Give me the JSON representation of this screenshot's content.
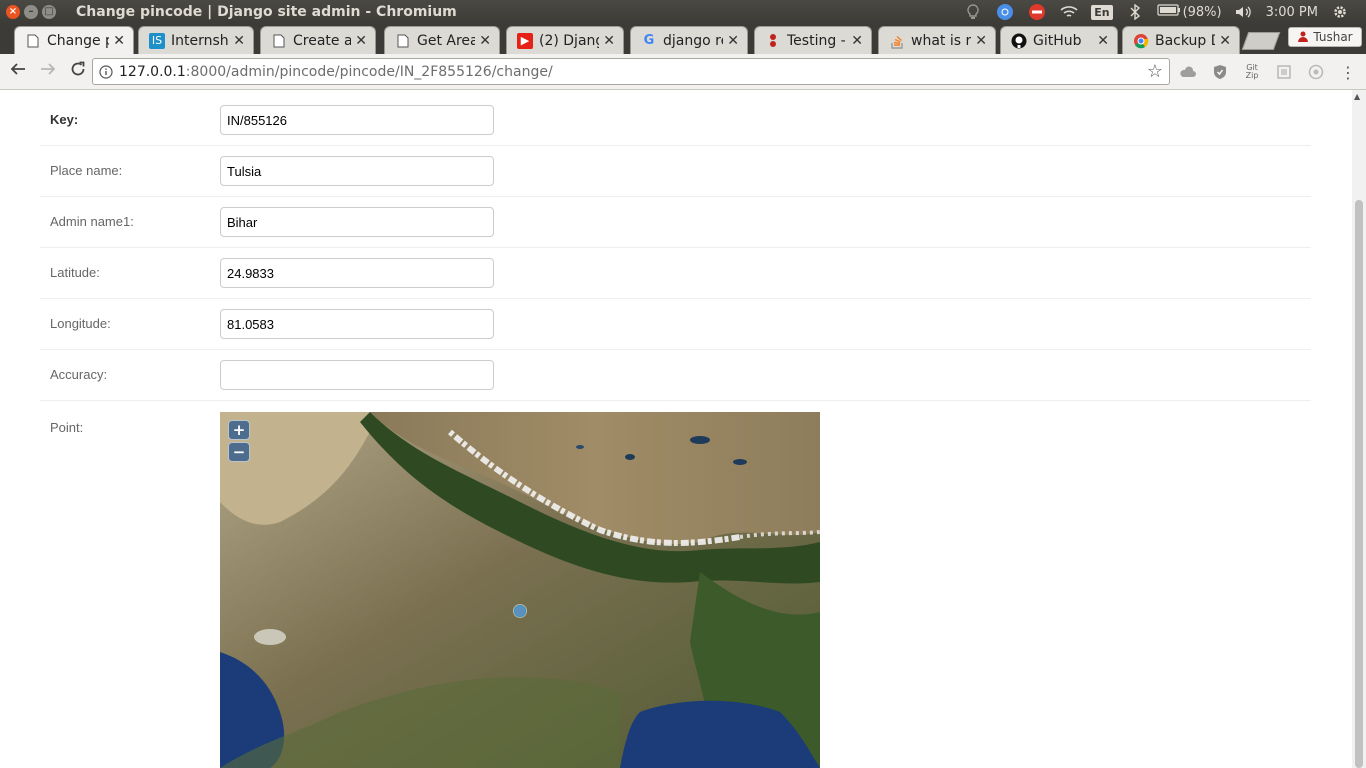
{
  "window": {
    "title": "Change pincode | Django site admin - Chromium",
    "battery": "(98%)",
    "clock": "3:00 PM",
    "keyboard": "En"
  },
  "tabs": [
    {
      "label": "Change p",
      "icon": "page-icon",
      "active": true
    },
    {
      "label": "Internshi",
      "icon": "internshala-icon"
    },
    {
      "label": "Create a",
      "icon": "page-icon"
    },
    {
      "label": "Get Area",
      "icon": "page-icon"
    },
    {
      "label": "(2) Djang",
      "icon": "youtube-icon"
    },
    {
      "label": "django re",
      "icon": "google-icon"
    },
    {
      "label": "Testing -",
      "icon": "testing-icon"
    },
    {
      "label": "what is r",
      "icon": "stackoverflow-icon"
    },
    {
      "label": "GitHub",
      "icon": "github-icon"
    },
    {
      "label": "Backup D",
      "icon": "chrome-icon"
    }
  ],
  "profile": {
    "name": "Tushar"
  },
  "address": {
    "host": "127.0.0.1",
    "path": ":8000/admin/pincode/pincode/IN_2F855126/change/"
  },
  "toolbar_ext": {
    "gitzip": "Git Zip"
  },
  "form": {
    "key": {
      "label": "Key:",
      "value": "IN/855126"
    },
    "place_name": {
      "label": "Place name:",
      "value": "Tulsia"
    },
    "admin_name1": {
      "label": "Admin name1:",
      "value": "Bihar"
    },
    "latitude": {
      "label": "Latitude:",
      "value": "24.9833"
    },
    "longitude": {
      "label": "Longitude:",
      "value": "81.0583"
    },
    "accuracy": {
      "label": "Accuracy:",
      "value": ""
    },
    "point": {
      "label": "Point:"
    }
  },
  "map": {
    "zoom_in": "+",
    "zoom_out": "−"
  },
  "colors": {
    "accent": "#e95420",
    "title_bar": "#3c3b37"
  }
}
